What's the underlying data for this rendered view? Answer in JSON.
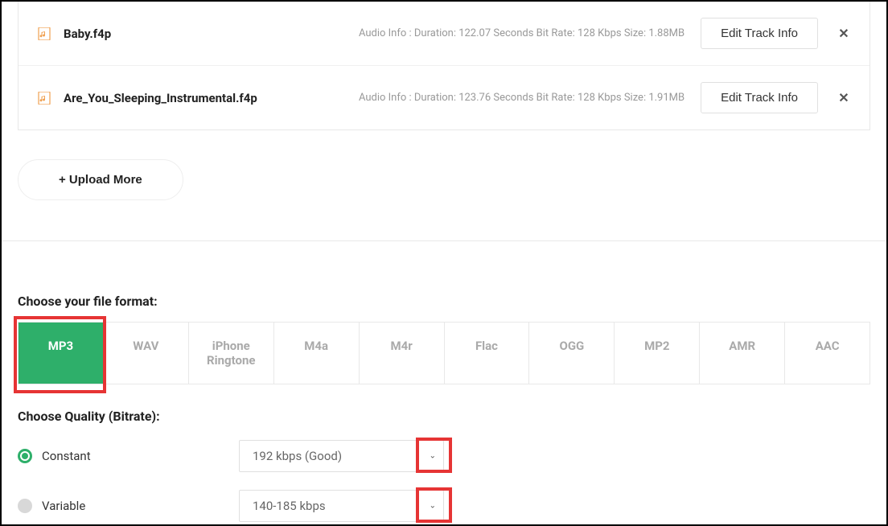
{
  "files": [
    {
      "name": "Baby.f4p",
      "info": "Audio Info : Duration: 122.07 Seconds Bit Rate: 128 Kbps Size: 1.88MB",
      "edit_label": "Edit Track Info"
    },
    {
      "name": "Are_You_Sleeping_Instrumental.f4p",
      "info": "Audio Info : Duration: 123.76 Seconds Bit Rate: 128 Kbps Size: 1.91MB",
      "edit_label": "Edit Track Info"
    }
  ],
  "upload_more_label": "+ Upload More",
  "format_section_label": "Choose your file format:",
  "formats": [
    "MP3",
    "WAV",
    "iPhone Ringtone",
    "M4a",
    "M4r",
    "Flac",
    "OGG",
    "MP2",
    "AMR",
    "AAC"
  ],
  "quality_section_label": "Choose Quality (Bitrate):",
  "quality": {
    "constant_label": "Constant",
    "constant_value": "192 kbps (Good)",
    "variable_label": "Variable",
    "variable_value": "140-185 kbps"
  }
}
